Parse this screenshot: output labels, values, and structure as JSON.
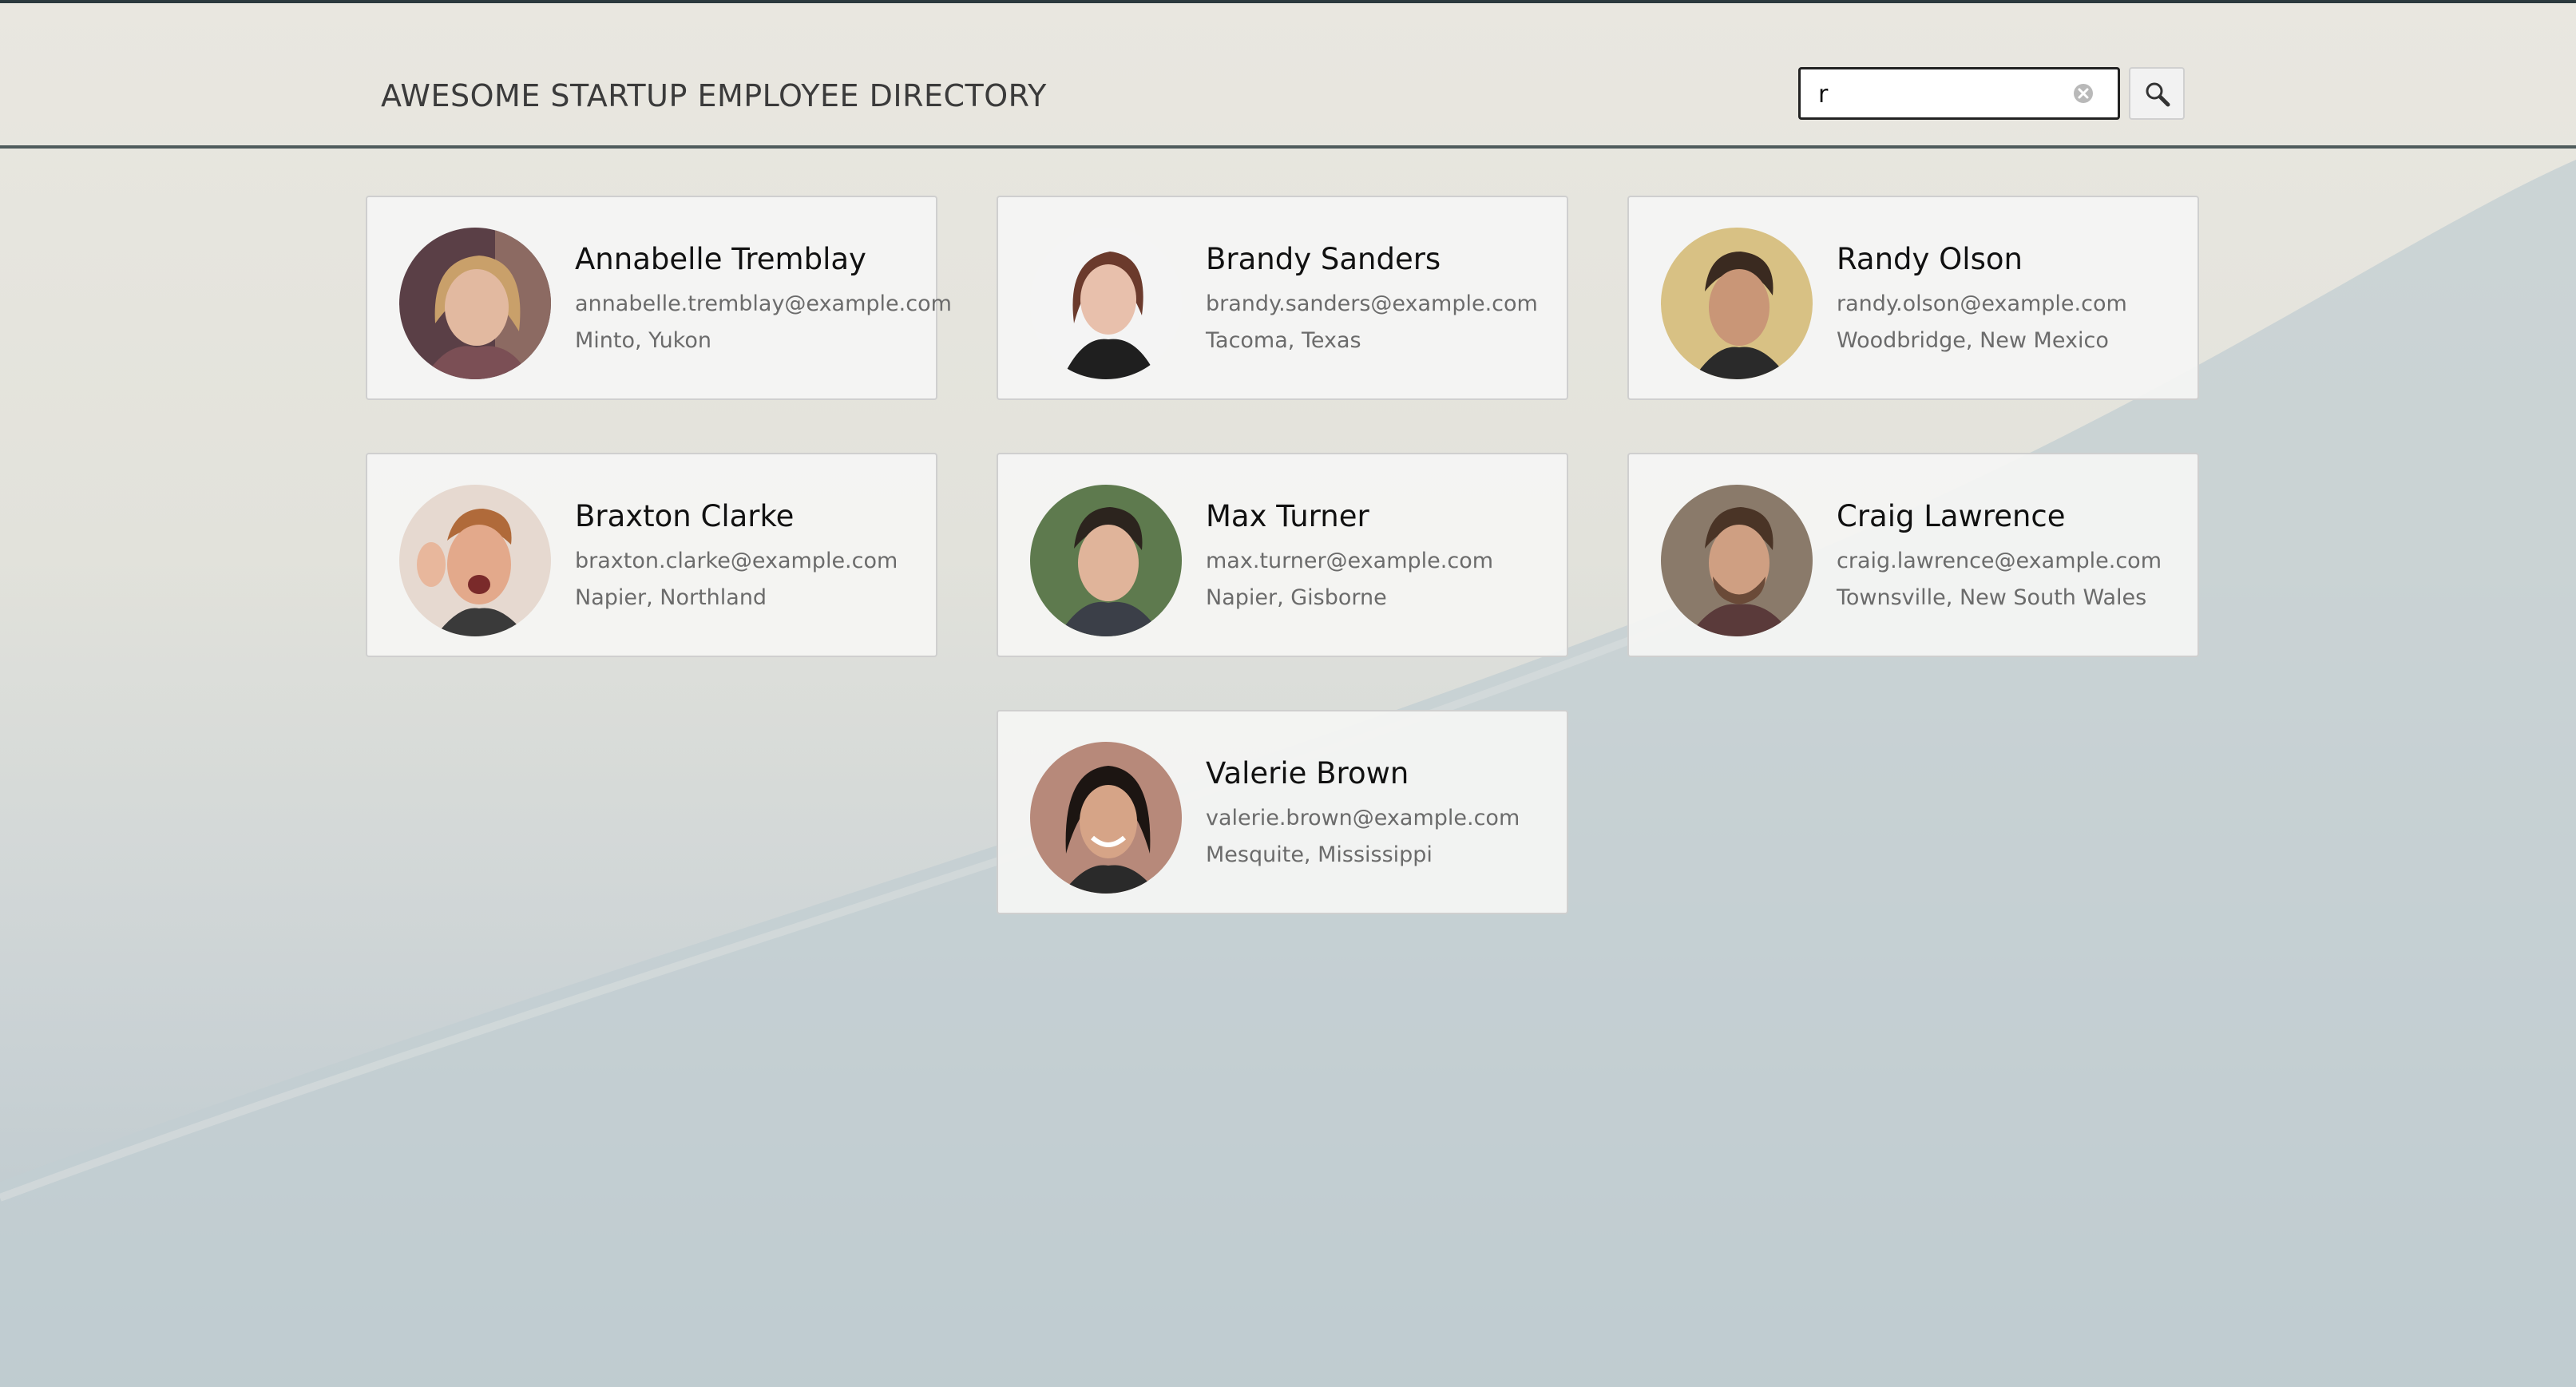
{
  "header": {
    "title": "AWESOME STARTUP EMPLOYEE DIRECTORY"
  },
  "search": {
    "value": "r",
    "clear_icon": "clear-icon",
    "button_icon": "magnifier-icon"
  },
  "employees": [
    {
      "name": "Annabelle Tremblay",
      "email": "annabelle.tremblay@example.com",
      "location": "Minto, Yukon"
    },
    {
      "name": "Brandy Sanders",
      "email": "brandy.sanders@example.com",
      "location": "Tacoma, Texas"
    },
    {
      "name": "Randy Olson",
      "email": "randy.olson@example.com",
      "location": "Woodbridge, New Mexico"
    },
    {
      "name": "Braxton Clarke",
      "email": "braxton.clarke@example.com",
      "location": "Napier, Northland"
    },
    {
      "name": "Max Turner",
      "email": "max.turner@example.com",
      "location": "Napier, Gisborne"
    },
    {
      "name": "Craig Lawrence",
      "email": "craig.lawrence@example.com",
      "location": "Townsville, New South Wales"
    },
    {
      "name": "Valerie Brown",
      "email": "valerie.brown@example.com",
      "location": "Mesquite, Mississippi"
    }
  ],
  "colors": {
    "title": "#3b3b3b",
    "card_bg": "#f5f5f4",
    "secondary_text": "#6b6b6b"
  }
}
